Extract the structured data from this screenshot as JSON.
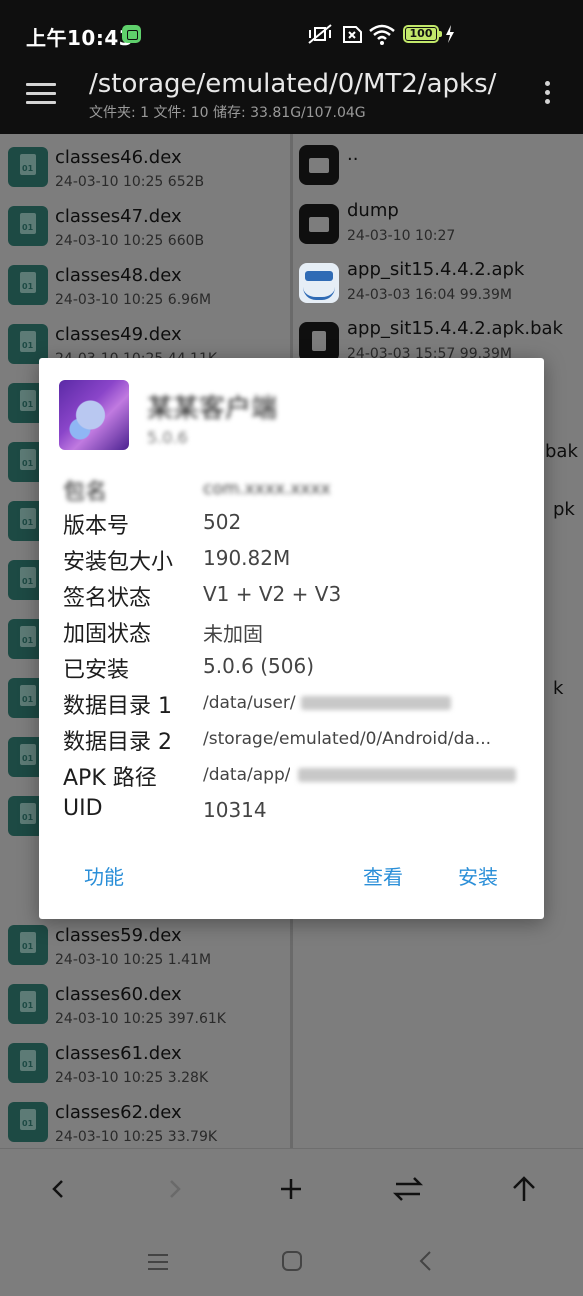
{
  "status_bar": {
    "time": "上午10:43",
    "battery": "100"
  },
  "app_bar": {
    "path": "/storage/emulated/0/MT2/apks/",
    "info": "文件夹: 1  文件: 10  储存: 33.81G/107.04G"
  },
  "left_pane": {
    "items": [
      {
        "name": "classes46.dex",
        "meta": "24-03-10 10:25  652B"
      },
      {
        "name": "classes47.dex",
        "meta": "24-03-10 10:25  660B"
      },
      {
        "name": "classes48.dex",
        "meta": "24-03-10 10:25  6.96M"
      },
      {
        "name": "classes49.dex",
        "meta": "24-03-10 10:25  44.11K"
      },
      {
        "name": "classes59.dex",
        "meta": "24-03-10 10:25  1.41M"
      },
      {
        "name": "classes60.dex",
        "meta": "24-03-10 10:25  397.61K"
      },
      {
        "name": "classes61.dex",
        "meta": "24-03-10 10:25  3.28K"
      },
      {
        "name": "classes62.dex",
        "meta": "24-03-10 10:25  33.79K"
      }
    ]
  },
  "right_pane": {
    "items": [
      {
        "name": "..",
        "meta": ""
      },
      {
        "name": "dump",
        "meta": "24-03-10 10:27"
      },
      {
        "name": "app_sit15.4.4.2.apk",
        "meta": "24-03-03 16:04  99.39M"
      },
      {
        "name": "app_sit15.4.4.2.apk.bak",
        "meta": "24-03-03 15:57  99.39M"
      }
    ],
    "partial": [
      "bak",
      "pk",
      "k"
    ]
  },
  "dialog": {
    "app_name": "某某客户端",
    "app_version": "5.0.6",
    "package_label": "包名",
    "package_value": "com.xxxx.xxxx",
    "rows": [
      {
        "key": "版本号",
        "value": "502"
      },
      {
        "key": "安装包大小",
        "value": "190.82M"
      },
      {
        "key": "签名状态",
        "value": "V1 + V2 + V3"
      },
      {
        "key": "加固状态",
        "value": "未加固"
      },
      {
        "key": "已安装",
        "value": "5.0.6 (506)"
      },
      {
        "key": "数据目录 1",
        "value": "/data/user/"
      },
      {
        "key": "数据目录 2",
        "value": "/storage/emulated/0/Android/da..."
      },
      {
        "key": "APK 路径",
        "value": "/data/app/"
      },
      {
        "key": "UID",
        "value": "10314"
      }
    ],
    "buttons": {
      "functions": "功能",
      "view": "查看",
      "install": "安装"
    }
  },
  "toolbar": {
    "icons": [
      "back-icon",
      "forward-icon",
      "add-icon",
      "swap-icon",
      "up-icon"
    ]
  },
  "colors": {
    "accent": "#2b8fd8",
    "file_icon": "#1d4a44",
    "appbar": "#0f0f0f"
  }
}
